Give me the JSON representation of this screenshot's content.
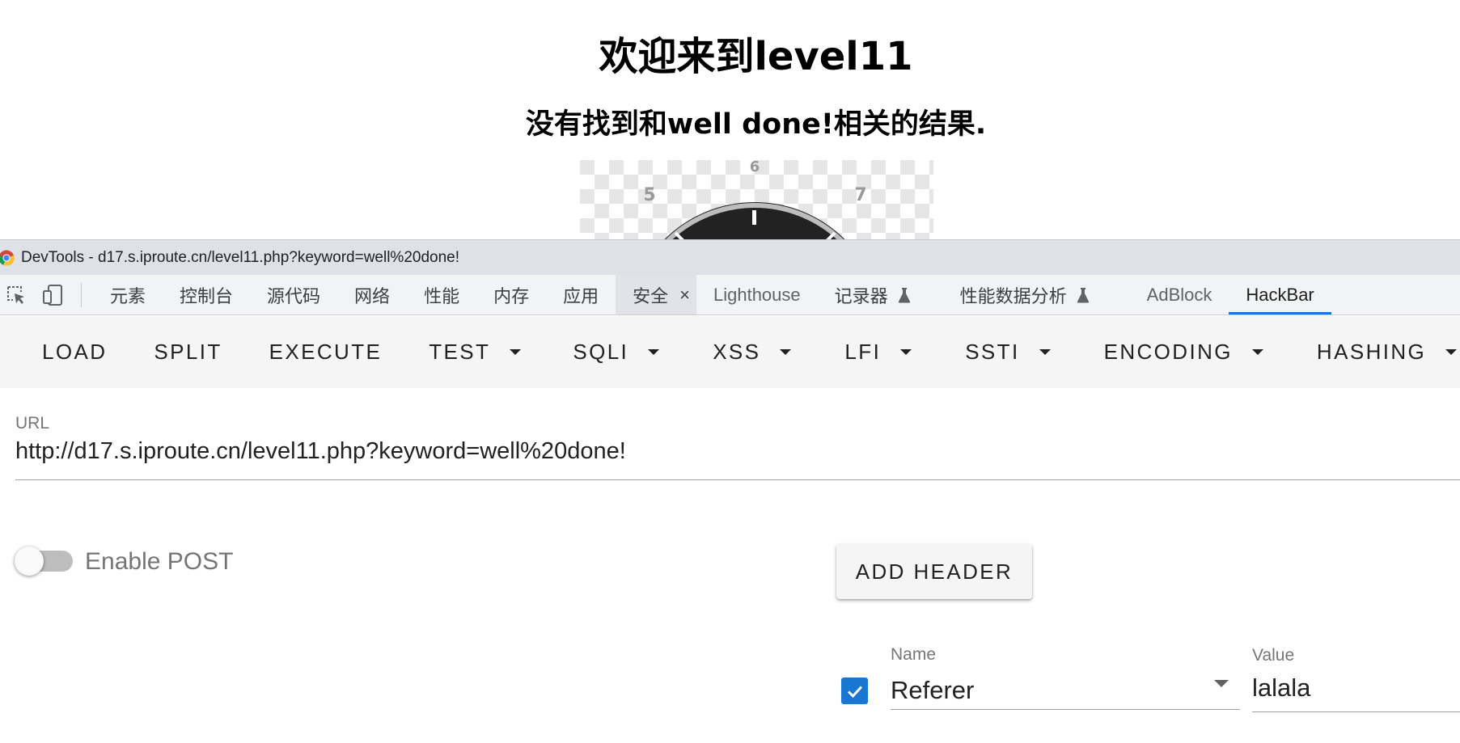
{
  "page": {
    "title": "欢迎来到level11",
    "subtitle": "没有找到和well done!相关的结果."
  },
  "devtools": {
    "window_title": "DevTools - d17.s.iproute.cn/level11.php?keyword=well%20done!",
    "tabs": [
      {
        "label": "元素"
      },
      {
        "label": "控制台"
      },
      {
        "label": "源代码"
      },
      {
        "label": "网络"
      },
      {
        "label": "性能"
      },
      {
        "label": "内存"
      },
      {
        "label": "应用"
      },
      {
        "label": "安全"
      },
      {
        "label": "Lighthouse"
      },
      {
        "label": "记录器"
      },
      {
        "label": "性能数据分析"
      },
      {
        "label": "AdBlock"
      },
      {
        "label": "HackBar"
      }
    ],
    "close_glyph": "×"
  },
  "hackbar": {
    "toolbar": {
      "load": "LOAD",
      "split": "SPLIT",
      "execute": "EXECUTE",
      "test": "TEST",
      "sqli": "SQLI",
      "xss": "XSS",
      "lfi": "LFI",
      "ssti": "SSTI",
      "encoding": "ENCODING",
      "hashing": "HASHING"
    },
    "url": {
      "label": "URL",
      "value": "http://d17.s.iproute.cn/level11.php?keyword=well%20done!"
    },
    "enable_post": {
      "label": "Enable POST",
      "enabled": false
    },
    "add_header_label": "ADD HEADER",
    "header_row": {
      "checked": true,
      "name_label": "Name",
      "name_value": "Referer",
      "value_label": "Value",
      "value_value": "lalala"
    }
  },
  "colors": {
    "accent": "#1a73e8",
    "checkbox": "#1976d2",
    "toolbar_bg": "#f5f5f5",
    "titlebar_bg": "#dee1e6"
  },
  "icons": [
    "chrome-logo-icon",
    "inspect-element-icon",
    "device-toggle-icon",
    "close-icon",
    "flask-icon",
    "chevron-down-icon",
    "checkmark-icon"
  ]
}
